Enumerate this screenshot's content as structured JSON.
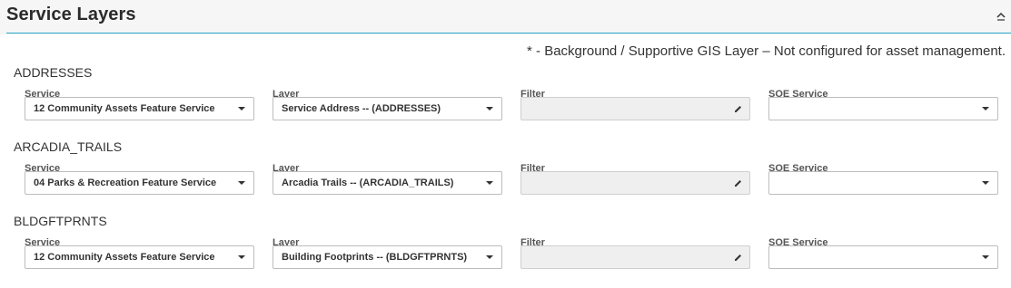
{
  "header": {
    "title": "Service Layers",
    "collapse_icon": "chevron-up-icon"
  },
  "note": "* - Background / Supportive GIS Layer – Not configured for asset management.",
  "labels": {
    "service": "Service",
    "layer": "Layer",
    "filter": "Filter",
    "soe_service": "SOE Service"
  },
  "groups": [
    {
      "title": "ADDRESSES",
      "service": "12 Community Assets Feature Service",
      "layer": "Service Address -- (ADDRESSES)",
      "filter": "",
      "soe_service": ""
    },
    {
      "title": "ARCADIA_TRAILS",
      "service": "04 Parks & Recreation Feature Service",
      "layer": "Arcadia Trails -- (ARCADIA_TRAILS)",
      "filter": "",
      "soe_service": ""
    },
    {
      "title": "BLDGFTPRNTS",
      "service": "12 Community Assets Feature Service",
      "layer": "Building Footprints -- (BLDGFTPRNTS)",
      "filter": "",
      "soe_service": ""
    }
  ],
  "colors": {
    "accent_line": "#2aa6c8",
    "header_bg": "#f6f6f6",
    "filter_bg": "#efefef"
  }
}
